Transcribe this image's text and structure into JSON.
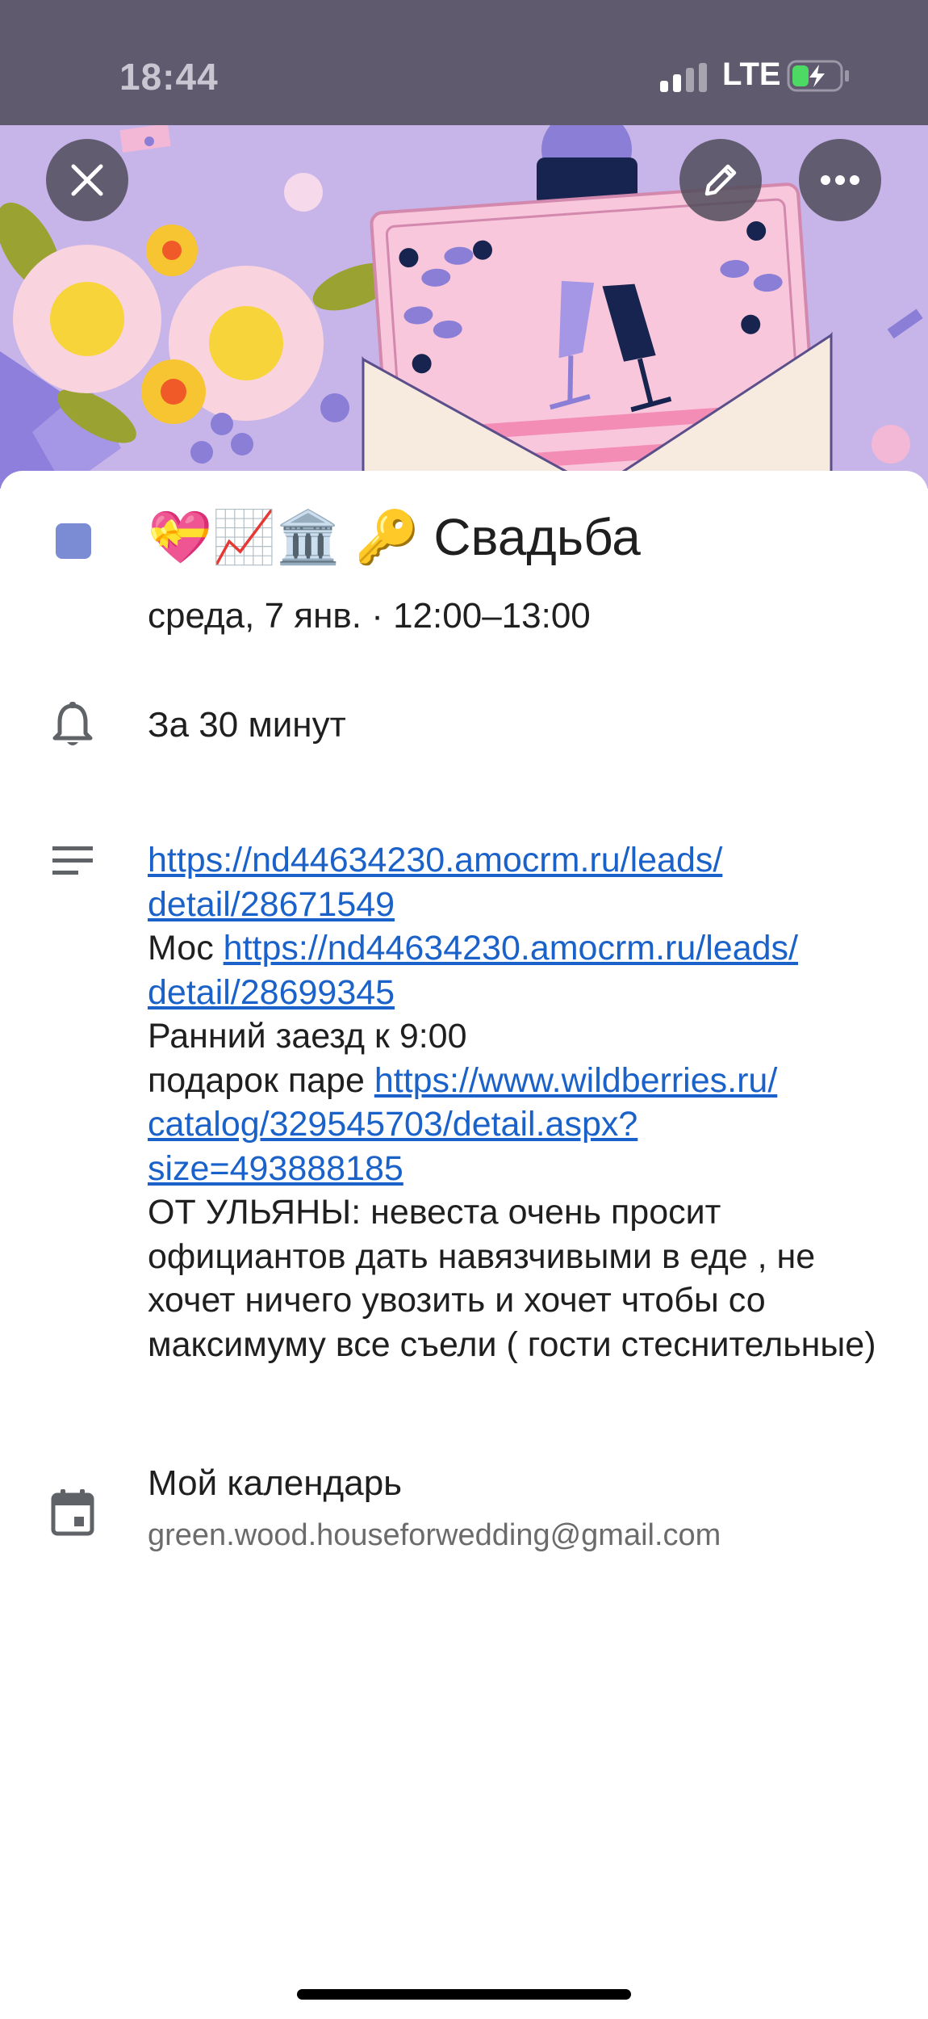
{
  "status_bar": {
    "time": "18:44",
    "network": "LTE"
  },
  "toolbar": {
    "close_icon": "close-icon",
    "edit_icon": "pencil-icon",
    "more_icon": "more-horizontal-icon"
  },
  "event": {
    "color": "#7b8bd4",
    "title": "💝📈🏛️ 🔑 Свадьба",
    "datetime": "среда, 7 янв. · 12:00–13:00",
    "reminder": "За 30 минут",
    "description": {
      "link1": "https://nd44634230.amocrm.ru/leads/detail/28671549",
      "line2_prefix": "Мос ",
      "link2": "https://nd44634230.amocrm.ru/leads/detail/28699345",
      "line3": "Ранний заезд к 9:00",
      "line4_prefix": "подарок паре ",
      "link3": "https://www.wildberries.ru/catalog/329545703/detail.aspx?size=493888185",
      "note": "ОТ УЛЬЯНЫ: невеста очень просит официантов дать навязчивыми в еде , не хочет ничего увозить и хочет чтобы со максимуму все съели ( гости стеснительные)"
    },
    "calendar": {
      "name": "Мой календарь",
      "email": "green.wood.houseforwedding@gmail.com"
    }
  },
  "colors": {
    "link": "#1a62c9",
    "status_bar_bg": "#5f5a6e",
    "hero_bg": "#c8b8ea"
  }
}
